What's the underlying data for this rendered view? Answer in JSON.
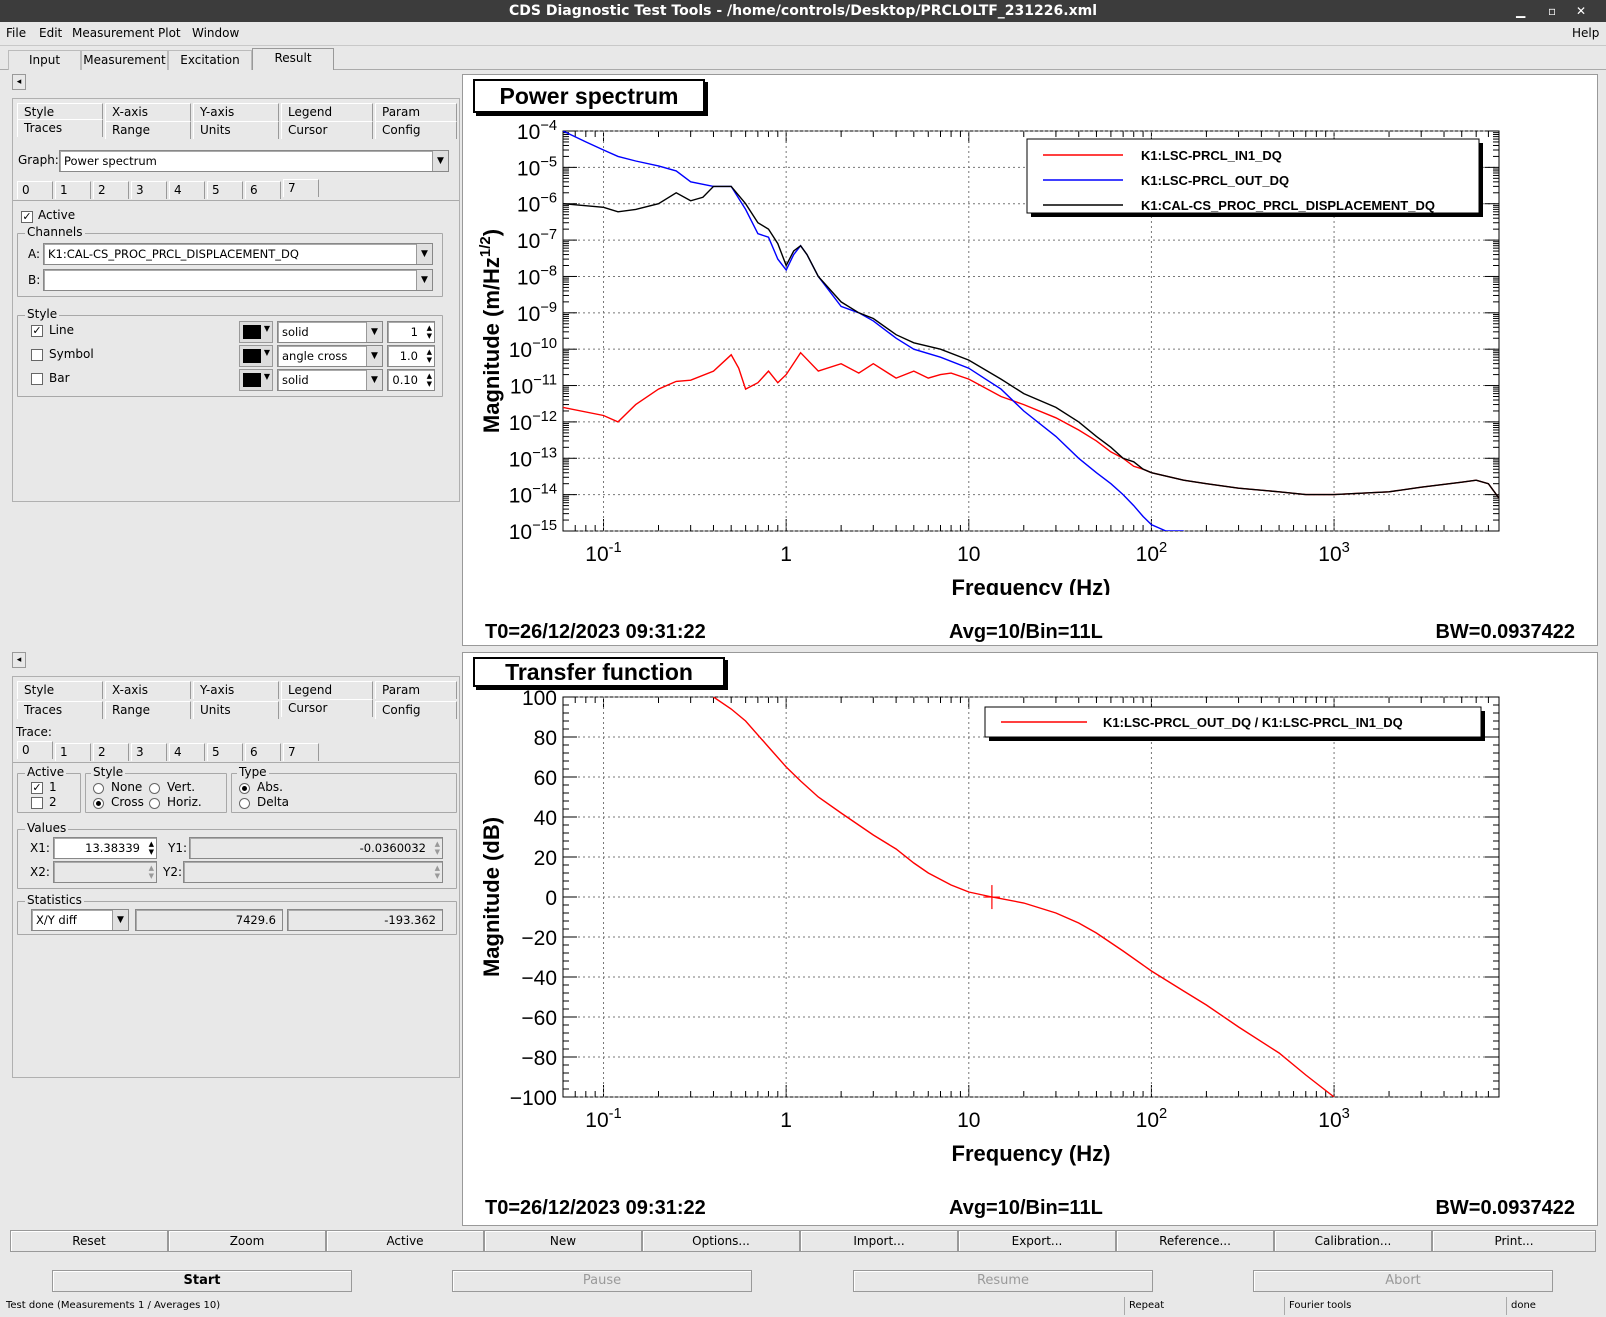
{
  "window": {
    "title": "CDS Diagnostic Test Tools - /home/controls/Desktop/PRCLOLTF_231226.xml"
  },
  "menus": [
    "File",
    "Edit",
    "Measurement",
    "Plot",
    "Window"
  ],
  "help": "Help",
  "main_tabs": [
    "Input",
    "Measurement",
    "Excitation",
    "Result"
  ],
  "upper_panel": {
    "collapse": "◂",
    "tabs_row1": [
      "Style",
      "X-axis",
      "Y-axis",
      "Legend",
      "Param"
    ],
    "tabs_row2": [
      "Traces",
      "Range",
      "Units",
      "Cursor",
      "Config"
    ],
    "graph_label": "Graph:",
    "graph_value": "Power spectrum",
    "trace_tabs": [
      "0",
      "1",
      "2",
      "3",
      "4",
      "5",
      "6",
      "7"
    ],
    "active_label": "Active",
    "channels_group": "Channels",
    "channel_a_label": "A:",
    "channel_a_value": "K1:CAL-CS_PROC_PRCL_DISPLACEMENT_DQ",
    "channel_b_label": "B:",
    "channel_b_value": "",
    "style_group": "Style",
    "style_rows": [
      {
        "label": "Line",
        "checked": true,
        "kind": "solid",
        "size": "1"
      },
      {
        "label": "Symbol",
        "checked": false,
        "kind": "angle cross",
        "size": "1.0"
      },
      {
        "label": "Bar",
        "checked": false,
        "kind": "solid",
        "size": "0.10"
      }
    ]
  },
  "lower_panel": {
    "collapse": "◂",
    "tabs_row1": [
      "Style",
      "X-axis",
      "Y-axis",
      "Legend",
      "Param"
    ],
    "tabs_row2": [
      "Traces",
      "Range",
      "Units",
      "Cursor",
      "Config"
    ],
    "trace_label": "Trace:",
    "trace_tabs": [
      "0",
      "1",
      "2",
      "3",
      "4",
      "5",
      "6",
      "7"
    ],
    "active_group": "Active",
    "active_items": [
      "1",
      "2"
    ],
    "style_group": "Style",
    "style_opts": [
      "None",
      "Vert.",
      "Cross",
      "Horiz."
    ],
    "type_group": "Type",
    "type_opts": [
      "Abs.",
      "Delta"
    ],
    "values_group": "Values",
    "x1_label": "X1:",
    "x1_value": "13.38339",
    "y1_label": "Y1:",
    "y1_value": "-0.0360032",
    "x2_label": "X2:",
    "x2_value": "",
    "y2_label": "Y2:",
    "y2_value": "",
    "stats_group": "Statistics",
    "stats_select": "X/Y diff",
    "stats_val1": "7429.6",
    "stats_val2": "-193.362"
  },
  "plot1": {
    "title": "Power spectrum",
    "footer_t0": "T0=26/12/2023 09:31:22",
    "footer_avg": "Avg=10/Bin=11L",
    "footer_bw": "BW=0.0937422"
  },
  "plot2": {
    "title": "Transfer function",
    "footer_t0": "T0=26/12/2023 09:31:22",
    "footer_avg": "Avg=10/Bin=11L",
    "footer_bw": "BW=0.0937422"
  },
  "chart_data": [
    {
      "type": "line",
      "title": "Power spectrum",
      "xlabel": "Frequency (Hz)",
      "ylabel": "Magnitude (m/Hz^1/2)",
      "xscale": "log",
      "yscale": "log",
      "xlim": [
        0.06,
        8000
      ],
      "ylim": [
        1e-15,
        0.0001
      ],
      "x_ticks": [
        "10^-1",
        "1",
        "10",
        "10^2",
        "10^3"
      ],
      "y_ticks": [
        "10^-4",
        "10^-5",
        "10^-6",
        "10^-7",
        "10^-8",
        "10^-9",
        "10^-10",
        "10^-11",
        "10^-12",
        "10^-13",
        "10^-14",
        "10^-15"
      ],
      "grid": true,
      "legend": "top-right",
      "series": [
        {
          "name": "K1:LSC-PRCL_IN1_DQ",
          "color": "#ff0000",
          "x": [
            0.06,
            0.1,
            0.12,
            0.15,
            0.2,
            0.25,
            0.3,
            0.4,
            0.5,
            0.55,
            0.6,
            0.7,
            0.8,
            0.9,
            1.0,
            1.2,
            1.5,
            2,
            2.5,
            3,
            4,
            5,
            6,
            7,
            8,
            10,
            15,
            20,
            30,
            40,
            50,
            60,
            70,
            80,
            90,
            100,
            150,
            200,
            300,
            500,
            700,
            1000,
            2000,
            3000,
            5000,
            6000,
            7000,
            8000
          ],
          "y": [
            2.5e-12,
            1.5e-12,
            1e-12,
            3e-12,
            8e-12,
            1.3e-11,
            1.4e-11,
            2.5e-11,
            7e-11,
            3e-11,
            8e-12,
            1.2e-11,
            2.5e-11,
            1.2e-11,
            2e-11,
            8e-11,
            2.5e-11,
            4e-11,
            2.2e-11,
            4e-11,
            1.6e-11,
            2.5e-11,
            1.6e-11,
            2e-11,
            2.2e-11,
            1.5e-11,
            5e-12,
            3e-12,
            1.3e-12,
            6e-13,
            3e-13,
            1.5e-13,
            1e-13,
            6e-14,
            5e-14,
            4e-14,
            2.5e-14,
            2e-14,
            1.5e-14,
            1.2e-14,
            1e-14,
            1e-14,
            1.2e-14,
            1.6e-14,
            2.2e-14,
            2.5e-14,
            2e-14,
            8e-15
          ]
        },
        {
          "name": "K1:LSC-PRCL_OUT_DQ",
          "color": "#0000ff",
          "x": [
            0.06,
            0.08,
            0.1,
            0.12,
            0.15,
            0.2,
            0.25,
            0.3,
            0.4,
            0.5,
            0.6,
            0.7,
            0.8,
            0.9,
            1.0,
            1.1,
            1.2,
            1.3,
            1.5,
            2,
            2.5,
            3,
            4,
            5,
            7,
            10,
            15,
            20,
            30,
            40,
            50,
            60,
            70,
            80,
            90,
            100,
            120,
            150
          ],
          "y": [
            0.0001,
            5e-05,
            3e-05,
            2e-05,
            1.5e-05,
            1.1e-05,
            8e-06,
            4e-06,
            3e-06,
            3e-06,
            7e-07,
            1.5e-07,
            1.2e-07,
            3e-08,
            1.5e-08,
            4e-08,
            7e-08,
            4e-08,
            1e-08,
            1.5e-09,
            1e-09,
            6e-10,
            2e-10,
            1e-10,
            6e-11,
            3e-11,
            8e-12,
            2e-12,
            4e-13,
            1e-13,
            4e-14,
            2e-14,
            1e-14,
            5e-15,
            2.5e-15,
            1.5e-15,
            1e-15,
            1e-15
          ]
        },
        {
          "name": "K1:CAL-CS_PROC_PRCL_DISPLACEMENT_DQ",
          "color": "#000000",
          "x": [
            0.06,
            0.1,
            0.12,
            0.15,
            0.2,
            0.25,
            0.3,
            0.35,
            0.4,
            0.5,
            0.6,
            0.7,
            0.8,
            0.9,
            1.0,
            1.1,
            1.2,
            1.3,
            1.5,
            2,
            2.5,
            3,
            4,
            5,
            7,
            10,
            15,
            20,
            30,
            40,
            50,
            60,
            70,
            80,
            90,
            100,
            150,
            200,
            300,
            500,
            700,
            1000,
            2000,
            3000,
            5000,
            6000,
            7000,
            8000
          ],
          "y": [
            1e-06,
            8e-07,
            6e-07,
            7e-07,
            1e-06,
            2e-06,
            1.2e-06,
            1.5e-06,
            3e-06,
            3e-06,
            1e-06,
            3e-07,
            2e-07,
            8e-08,
            2e-08,
            5e-08,
            7e-08,
            4e-08,
            1e-08,
            2e-09,
            1e-09,
            7e-10,
            2.5e-10,
            1.5e-10,
            1e-10,
            5e-11,
            1.5e-11,
            6e-12,
            2.5e-12,
            1e-12,
            4e-13,
            2e-13,
            1e-13,
            8e-14,
            5e-14,
            4e-14,
            2.5e-14,
            2e-14,
            1.5e-14,
            1.2e-14,
            1e-14,
            1e-14,
            1.2e-14,
            1.6e-14,
            2.2e-14,
            2.5e-14,
            2e-14,
            8e-15
          ]
        }
      ]
    },
    {
      "type": "line",
      "title": "Transfer function",
      "xlabel": "Frequency (Hz)",
      "ylabel": "Magnitude (dB)",
      "xscale": "log",
      "xlim": [
        0.06,
        8000
      ],
      "ylim": [
        -100,
        100
      ],
      "x_ticks": [
        "10^-1",
        "1",
        "10",
        "10^2",
        "10^3"
      ],
      "y_ticks": [
        100,
        80,
        60,
        40,
        20,
        0,
        -20,
        -40,
        -60,
        -80,
        -100
      ],
      "grid": true,
      "legend": "top-right",
      "cursor": {
        "x": 13.38339,
        "y": -0.0360032
      },
      "series": [
        {
          "name": "K1:LSC-PRCL_OUT_DQ / K1:LSC-PRCL_IN1_DQ",
          "color": "#ff0000",
          "x": [
            0.4,
            0.5,
            0.6,
            0.8,
            1.0,
            1.2,
            1.5,
            2,
            3,
            4,
            5,
            6,
            8,
            10,
            13.4,
            20,
            30,
            40,
            50,
            70,
            100,
            150,
            200,
            300,
            500,
            700,
            1000
          ],
          "y": [
            100,
            94,
            88,
            75,
            65,
            58,
            50,
            42,
            31,
            24,
            17,
            12,
            6,
            2.5,
            0,
            -3,
            -8,
            -13,
            -18,
            -27,
            -37,
            -47,
            -54,
            -65,
            -78,
            -89,
            -100
          ]
        }
      ]
    }
  ]
}
